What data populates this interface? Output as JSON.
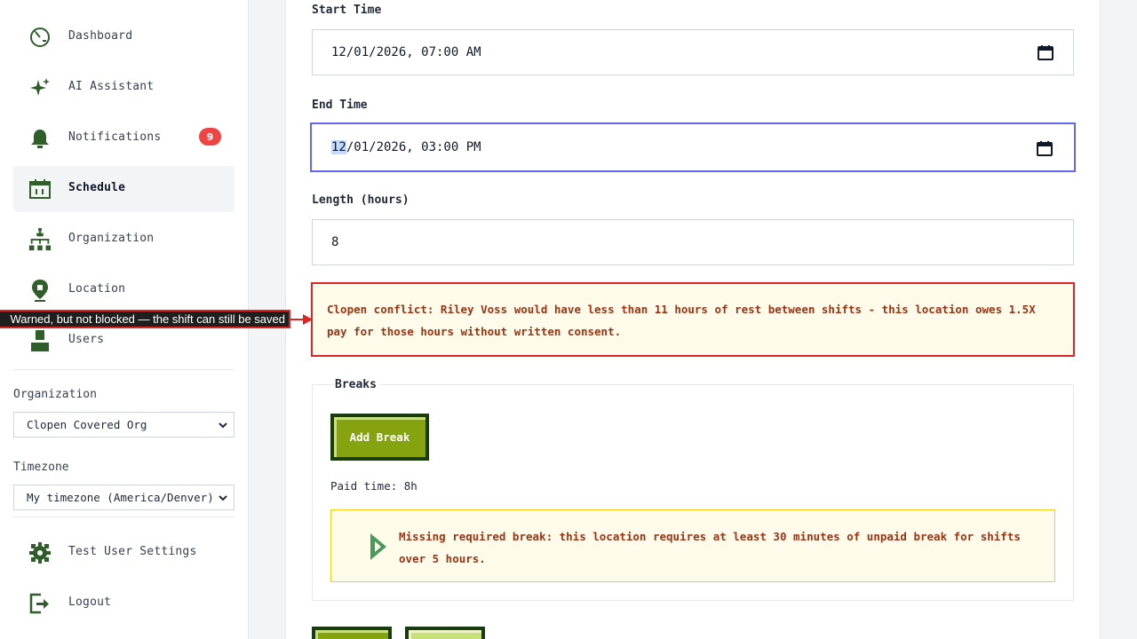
{
  "sidebar": {
    "items": [
      {
        "label": "Dashboard",
        "icon": "dashboard-icon"
      },
      {
        "label": "AI Assistant",
        "icon": "sparkle-icon"
      },
      {
        "label": "Notifications",
        "icon": "bell-icon",
        "badge": "9"
      },
      {
        "label": "Schedule",
        "icon": "calendar-icon",
        "active": true
      },
      {
        "label": "Organization",
        "icon": "org-chart-icon"
      },
      {
        "label": "Location",
        "icon": "location-pin-icon"
      },
      {
        "label": "Users",
        "icon": "user-icon"
      }
    ],
    "organization_label": "Organization",
    "organization_value": "Clopen Covered Org",
    "timezone_label": "Timezone",
    "timezone_value": "My timezone (America/Denver)",
    "settings_label": "Test User Settings",
    "logout_label": "Logout"
  },
  "form": {
    "start_label": "Start Time",
    "start_value": "12/01/2026, 07:00 AM",
    "end_label": "End Time",
    "end_value_highlight": "12",
    "end_value_rest": "/01/2026, 03:00 PM",
    "length_label": "Length (hours)",
    "length_value": "8",
    "clopen_alert": "Clopen conflict: Riley Voss would have less than 11 hours of rest between shifts - this location owes 1.5X pay for those hours without written consent.",
    "breaks_legend": "Breaks",
    "add_break_label": "Add Break",
    "paid_time": "Paid time: 8h",
    "break_alert": "Missing required break: this location requires at least 30 minutes of unpaid break for shifts over 5 hours."
  },
  "annotation": {
    "text": "Warned, but not blocked — the shift can still be saved"
  },
  "colors": {
    "accent_green": "#84a30f",
    "dark_green": "#1a3a0f",
    "icon_green": "#2f5e2a",
    "alert_red": "#dc2626",
    "focus_blue": "#6366f1",
    "badge_red": "#ef4444"
  }
}
